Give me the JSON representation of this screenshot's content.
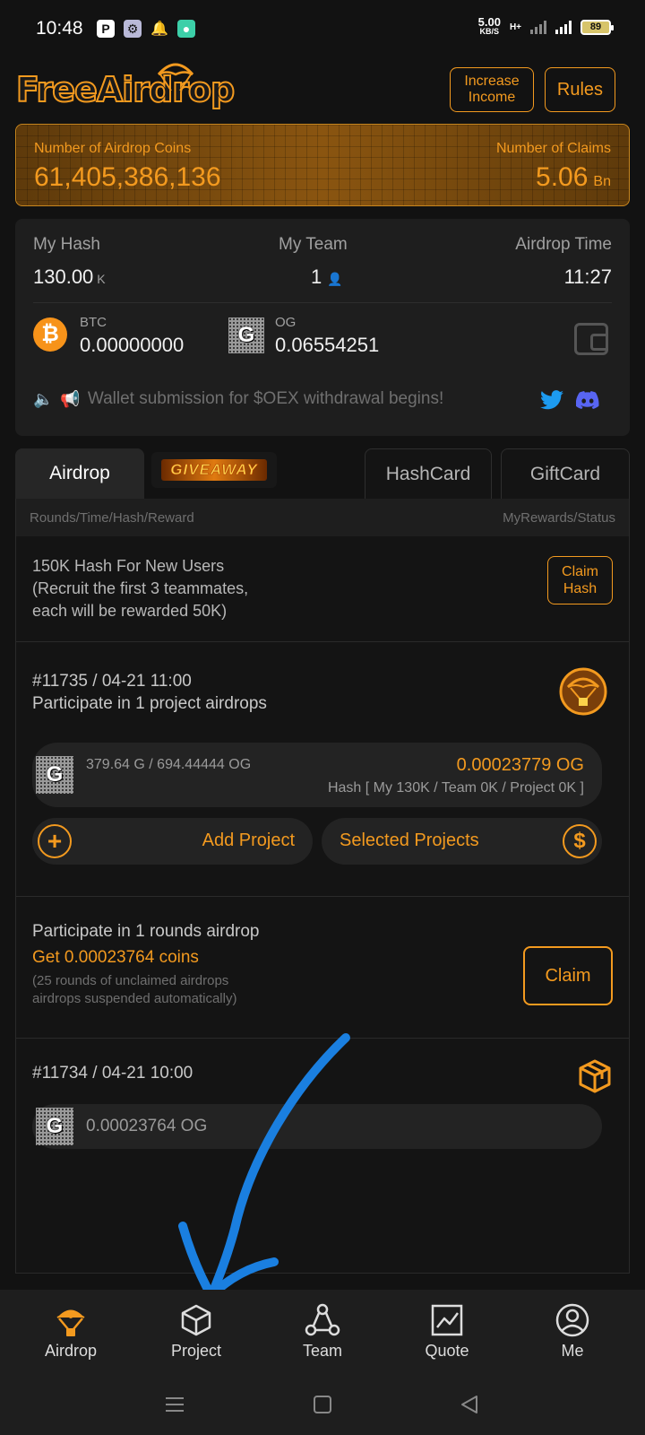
{
  "status_bar": {
    "time": "10:48",
    "speed": "5.00",
    "speed_unit": "KB/S",
    "network": "H+",
    "battery": "89"
  },
  "header": {
    "logo": "FreeAirdrop",
    "increase_income_line1": "Increase",
    "increase_income_line2": "Income",
    "rules": "Rules"
  },
  "coins": {
    "coins_label": "Number of Airdrop Coins",
    "coins_value": "61,405,386,136",
    "claims_label": "Number of Claims",
    "claims_value": "5.06",
    "claims_unit": "Bn"
  },
  "stats": {
    "hash_label": "My Hash",
    "hash_value": "130.00",
    "hash_unit": "K",
    "team_label": "My Team",
    "team_value": "1",
    "time_label": "Airdrop Time",
    "time_value": "11:27",
    "btc_label": "BTC",
    "btc_value": "0.00000000",
    "og_label": "OG",
    "og_value": "0.06554251",
    "notice": "Wallet submission for $OEX withdrawal begins!"
  },
  "tabs": {
    "airdrop": "Airdrop",
    "giveaway": "GIVEAWAY",
    "hashcard": "HashCard",
    "giftcard": "GiftCard"
  },
  "table_header": {
    "left": "Rounds/Time/Hash/Reward",
    "right": "MyRewards/Status"
  },
  "new_user": {
    "line1": "150K Hash For New Users",
    "line2": "(Recruit the first 3 teammates,",
    "line3": "each will be rewarded 50K)",
    "btn_line1": "Claim",
    "btn_line2": "Hash"
  },
  "round1": {
    "title": "#11735 / 04-21 11:00",
    "subtitle": "Participate in 1 project airdrops",
    "og_amount": "379.64 G / 694.44444 OG",
    "reward": "0.00023779 OG",
    "hash_info": "Hash [ My 130K / Team 0K / Project 0K ]",
    "add_project": "Add Project",
    "selected_projects": "Selected Projects"
  },
  "claim_section": {
    "line1": "Participate in 1 rounds airdrop",
    "line2": "Get 0.00023764 coins",
    "line3": "(25 rounds of unclaimed airdrops",
    "line4": "airdrops suspended automatically)",
    "claim": "Claim"
  },
  "round2": {
    "title": "#11734 / 04-21 10:00",
    "reward": "0.00023764 OG"
  },
  "bottom_nav": {
    "airdrop": "Airdrop",
    "project": "Project",
    "team": "Team",
    "quote": "Quote",
    "me": "Me"
  },
  "colors": {
    "accent": "#f39a1f",
    "background": "#121212",
    "annotation": "#1a7fe0"
  }
}
